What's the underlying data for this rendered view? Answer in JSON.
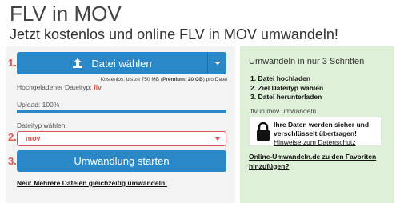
{
  "header": {
    "title": "FLV in MOV",
    "subtitle": "Jetzt kostenlos und online FLV in MOV umwandeln!"
  },
  "steps": {
    "step1": "1.",
    "step2": "2.",
    "step3": "3."
  },
  "upload": {
    "button_label": "Datei wählen",
    "limits_prefix": "Kostenlos: bis zu 750 MB (",
    "limits_premium": "Premium: 20 GB",
    "limits_suffix": ") pro Datei",
    "uploaded_label": "Hochgeladener Dateityp:",
    "uploaded_type": "flv",
    "progress_label": "Upload: 100%",
    "progress_value": 1.0
  },
  "filetype": {
    "label": "Dateityp wählen:",
    "selected": "mov"
  },
  "convert": {
    "button_label": "Umwandlung starten"
  },
  "multi_link": "Neu: Mehrere Dateien gleichzeitig umwandeln!",
  "sidebar": {
    "title": "Umwandeln in nur 3 Schritten",
    "steps": [
      "1. Datei hochladen",
      "2. Ziel Dateityp wählen",
      "3. Datei herunterladen"
    ],
    "flv_text": ".flv in mov umwandeln",
    "privacy_line1": "Ihre Daten werden sicher und",
    "privacy_line2": "verschlüsselt übertragen!",
    "privacy_link": "Hinweise zum Datenschutz",
    "fav_line1": "Online-Umwandeln.de zu den Favoriten",
    "fav_line2": "hinzufügen?"
  },
  "colors": {
    "primary": "#2a88c9",
    "accent_red": "#d9534f",
    "sidebar_bg": "#dff0d8"
  },
  "icons": {
    "upload": "upload-icon",
    "caret": "caret-down-icon",
    "lock": "lock-icon"
  }
}
